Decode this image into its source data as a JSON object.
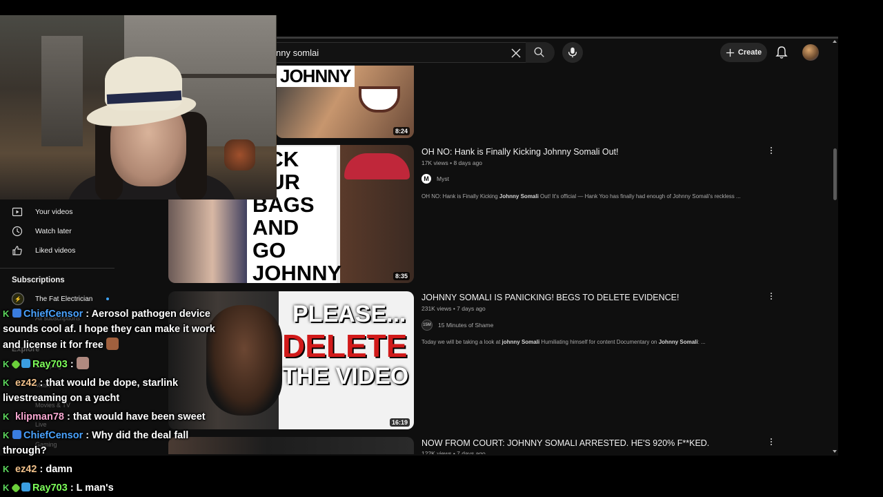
{
  "search": {
    "query": "nny somlai"
  },
  "header": {
    "create_label": "Create"
  },
  "sidebar": {
    "items": [
      {
        "label": "Your videos",
        "icon": "play-square-icon"
      },
      {
        "label": "Watch later",
        "icon": "clock-icon"
      },
      {
        "label": "Liked videos",
        "icon": "thumbs-up-icon"
      }
    ],
    "subscriptions_heading": "Subscriptions",
    "subscriptions": [
      {
        "label": "The Fat Electrician",
        "live": true
      }
    ],
    "faded": {
      "all_subs": "All subscriptions",
      "explore": "Explore",
      "shopping": "Shopping",
      "music": "Music",
      "movies": "Movies & TV",
      "live": "Live",
      "gaming": "Gaming"
    }
  },
  "videos": [
    {
      "thumb_text": "JOHNNY",
      "duration": "8:24"
    },
    {
      "thumb_text": "ACK\nOUR\nBAGS\nAND GO\nJOHNNY",
      "duration": "8:35",
      "title": "OH NO: Hank is Finally Kicking Johnny Somali Out!",
      "meta": "17K views • 8 days ago",
      "channel": "Myst",
      "channel_logo": "M",
      "desc_a": "OH NO: Hank is Finally Kicking ",
      "desc_b": "Johnny Somali",
      "desc_c": " Out! It's official — Hank Yoo has finally had enough of Johnny Somali's reckless ..."
    },
    {
      "thumb_l1": "PLEASE...",
      "thumb_l2": "DELETE",
      "thumb_l3": "THE VIDEO",
      "duration": "16:19",
      "title": "JOHNNY SOMALI IS PANICKING! BEGS TO DELETE EVIDENCE!",
      "meta": "231K views • 7 days ago",
      "channel": "15 Minutes of Shame",
      "channel_logo": "15M",
      "desc_a": "Today we will be taking a look at ",
      "desc_b": "johnny Somali",
      "desc_c": " Humiliating himself for content Documentary on ",
      "desc_d": "Johnny Somali",
      "desc_e": ": ..."
    },
    {
      "title": "NOW FROM COURT: JOHNNY SOMALI ARRESTED. HE'S 920% F**KED.",
      "meta": "122K views • 7 days ago"
    }
  ],
  "chat": [
    {
      "user": "ChiefCensor",
      "color": "#4aa3ff",
      "text": ": Aerosol pathogen device",
      "cont1": "sounds cool af. I hope they can make it work",
      "cont2": "and license it for free"
    },
    {
      "user": "Ray703",
      "color": "#7dff5a",
      "text": ":"
    },
    {
      "user": "ez42",
      "color": "#f0c08a",
      "text": ": that would be dope, starlink",
      "cont1": "livestreaming on a yacht"
    },
    {
      "user": "klipman78",
      "color": "#f7a6d0",
      "text": ": that would have been sweet"
    },
    {
      "user": "ChiefCensor",
      "color": "#4aa3ff",
      "text": ": Why did the deal fall",
      "cont1": "through?"
    },
    {
      "user": "ez42",
      "color": "#f0c08a",
      "text": ": damn"
    },
    {
      "user": "Ray703",
      "color": "#7dff5a",
      "text": ": L man's"
    }
  ]
}
